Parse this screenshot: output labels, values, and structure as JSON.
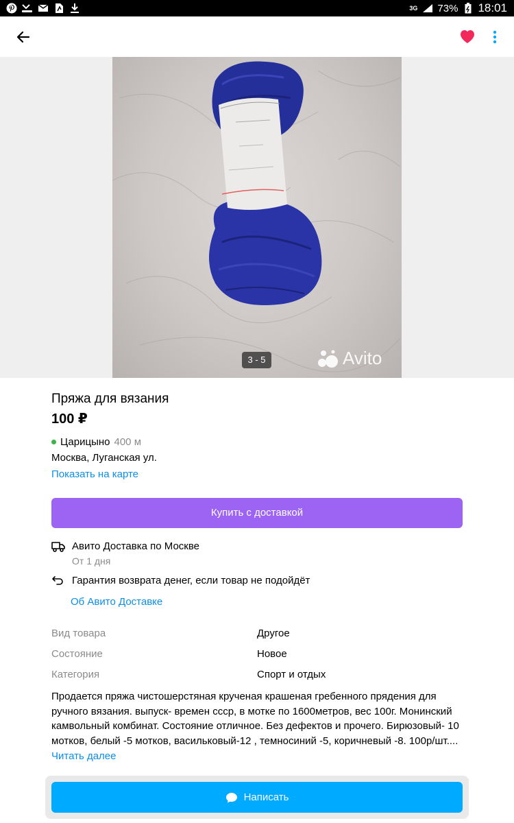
{
  "status_bar": {
    "network": "3G",
    "battery": "73%",
    "time": "18:01",
    "left_icons": [
      "pinterest-icon",
      "missed-call-icon",
      "mail-icon",
      "file-icon",
      "download-icon"
    ]
  },
  "app_bar": {
    "icons": [
      "back-arrow-icon",
      "heart-icon",
      "more-vertical-icon"
    ],
    "favorite_color": "#f2295b"
  },
  "gallery": {
    "counter": "3 - 5",
    "watermark": "Avito"
  },
  "listing": {
    "title": "Пряжа для вязания",
    "price": "100 ₽",
    "metro": "Царицыно",
    "metro_distance": "400 м",
    "metro_color": "#3cb44a",
    "address": "Москва, Луганская ул.",
    "map_link": "Показать на карте"
  },
  "buy_button": {
    "label": "Купить с доставкой",
    "color": "#9d63f2"
  },
  "delivery": {
    "title": "Авито Доставка по Москве",
    "subtitle": "От 1 дня",
    "guarantee": "Гарантия возврата денег, если товар не подойдёт",
    "about_link": "Об Авито Доставке"
  },
  "params": [
    {
      "key": "Вид товара",
      "value": "Другое"
    },
    {
      "key": "Состояние",
      "value": "Новое"
    },
    {
      "key": "Категория",
      "value": "Спорт и отдых"
    }
  ],
  "description": {
    "lines": [
      "Продается пряжа чистошерстяная крученая крашеная гребенного прядения для",
      "ручного вязания.  выпуск- времен ссср, в мотке по 1600метров, вес 100г. Монинский",
      "камвольный комбинат. Состояние отличное. Без дефектов и прочего. Бирюзовый- 10",
      "мотков, белый -5 мотков, васильковый-12 , темносиний -5, коричневый -8. 100р/шт...."
    ],
    "more_link": "Читать далее"
  },
  "write_button": {
    "label": "Написать",
    "color": "#00aaff"
  }
}
